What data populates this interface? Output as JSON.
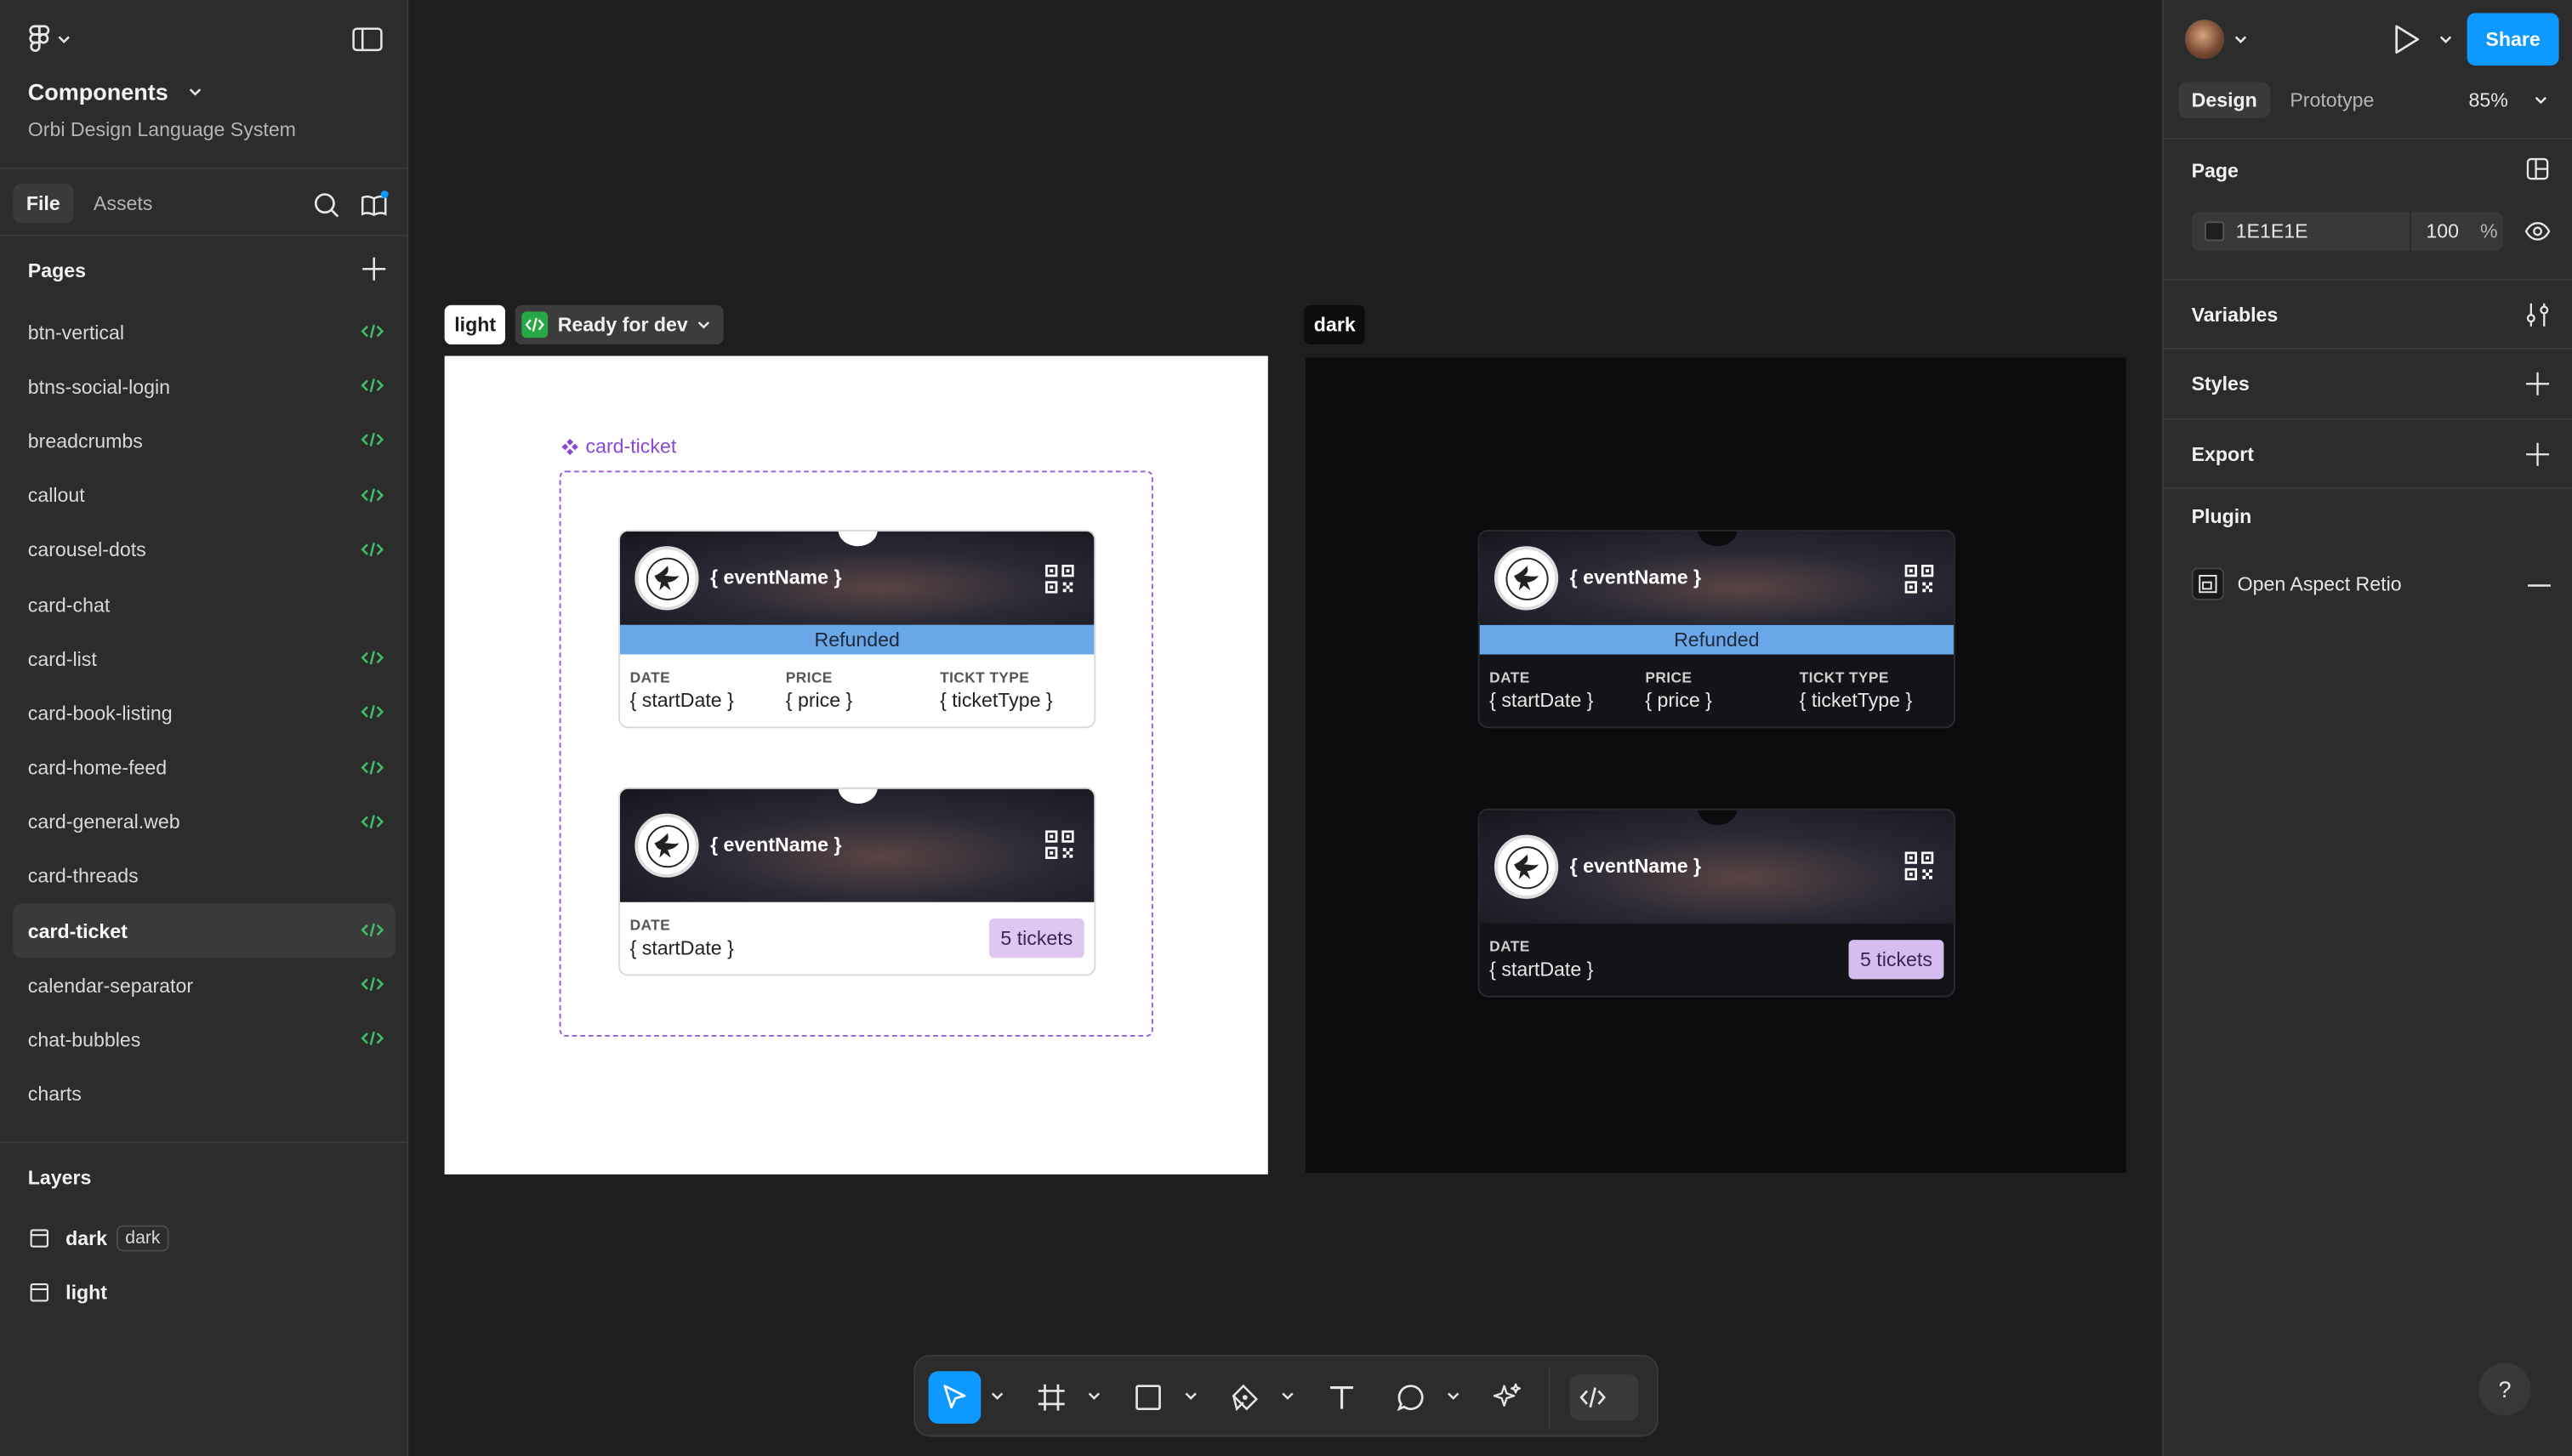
{
  "file": {
    "title": "Components",
    "subtitle": "Orbi Design Language System"
  },
  "sidebar": {
    "tabs": [
      {
        "label": "File"
      },
      {
        "label": "Assets"
      }
    ],
    "pages_heading": "Pages",
    "pages": [
      {
        "label": "btn-vertical"
      },
      {
        "label": "btns-social-login"
      },
      {
        "label": "breadcrumbs"
      },
      {
        "label": "callout"
      },
      {
        "label": "carousel-dots"
      },
      {
        "label": "card-chat"
      },
      {
        "label": "card-list"
      },
      {
        "label": "card-book-listing"
      },
      {
        "label": "card-home-feed"
      },
      {
        "label": "card-general.web"
      },
      {
        "label": "card-threads"
      },
      {
        "label": "card-ticket"
      },
      {
        "label": "calendar-separator"
      },
      {
        "label": "chat-bubbles"
      },
      {
        "label": "charts"
      }
    ],
    "layers_heading": "Layers",
    "layers": [
      {
        "label": "dark",
        "badge": "dark"
      },
      {
        "label": "light"
      }
    ]
  },
  "canvas": {
    "light_label": "light",
    "dark_label": "dark",
    "dev_status": "Ready for dev",
    "component_label": "card-ticket",
    "ticket": {
      "event_name": "{ eventName }",
      "status": "Refunded",
      "date_label": "DATE",
      "date_value": "{ startDate }",
      "price_label": "PRICE",
      "price_value": "{ price }",
      "type_label": "TICKT TYPE",
      "type_value": "{ ticketType }",
      "tickets_badge": "5 tickets"
    }
  },
  "right": {
    "share": "Share",
    "tabs": [
      {
        "label": "Design"
      },
      {
        "label": "Prototype"
      }
    ],
    "zoom": "85%",
    "page_heading": "Page",
    "bg_hex": "1E1E1E",
    "bg_opacity": "100",
    "percent": "%",
    "variables": "Variables",
    "styles": "Styles",
    "export": "Export",
    "plugin_heading": "Plugin",
    "plugin_name": "Open Aspect Retio",
    "help": "?"
  },
  "colors": {
    "accent": "#0d99ff",
    "ready": "#27a844",
    "component": "#8b47d9",
    "refunded": "#6aa7e8",
    "tickets_badge": "#e0c7f2"
  }
}
